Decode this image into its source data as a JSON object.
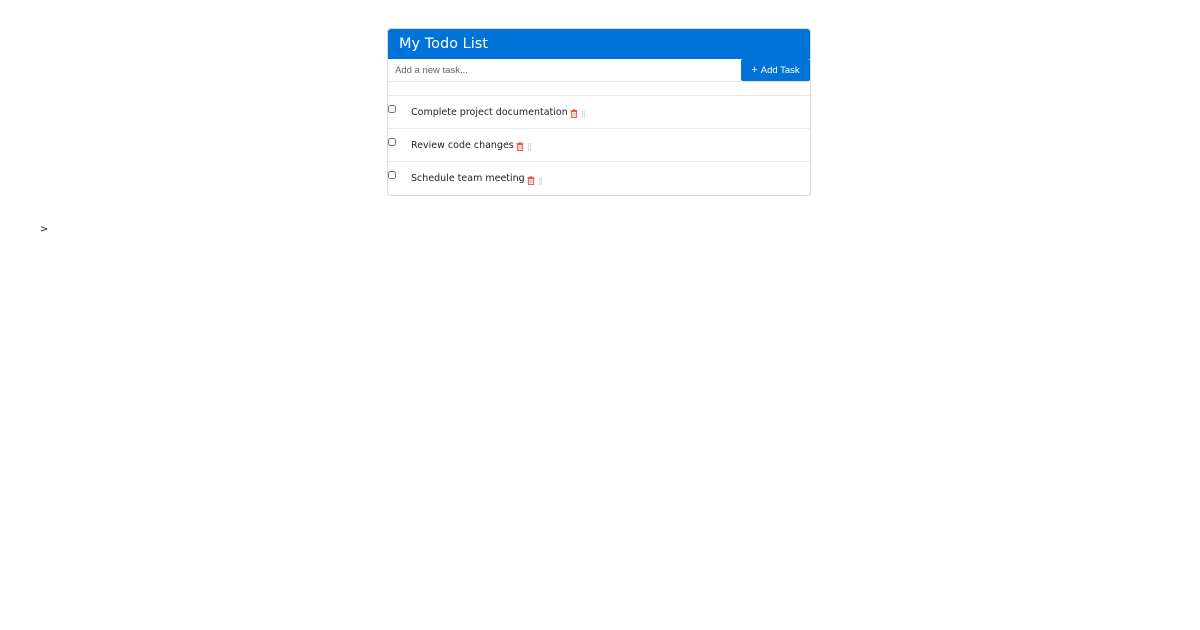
{
  "todo": {
    "title": "My Todo List",
    "input_placeholder": "Add a new task...",
    "add_button_label": "Add Task",
    "add_button_icon": "plus-icon",
    "tasks": [
      {
        "label": "Complete project documentation",
        "checked": false
      },
      {
        "label": "Review code changes",
        "checked": false
      },
      {
        "label": "Schedule team meeting",
        "checked": false
      }
    ]
  },
  "stray_text": ">",
  "colors": {
    "accent": "#0073d9",
    "delete_icon": "#e0463c",
    "drag_handle": "#9a9a9a"
  }
}
